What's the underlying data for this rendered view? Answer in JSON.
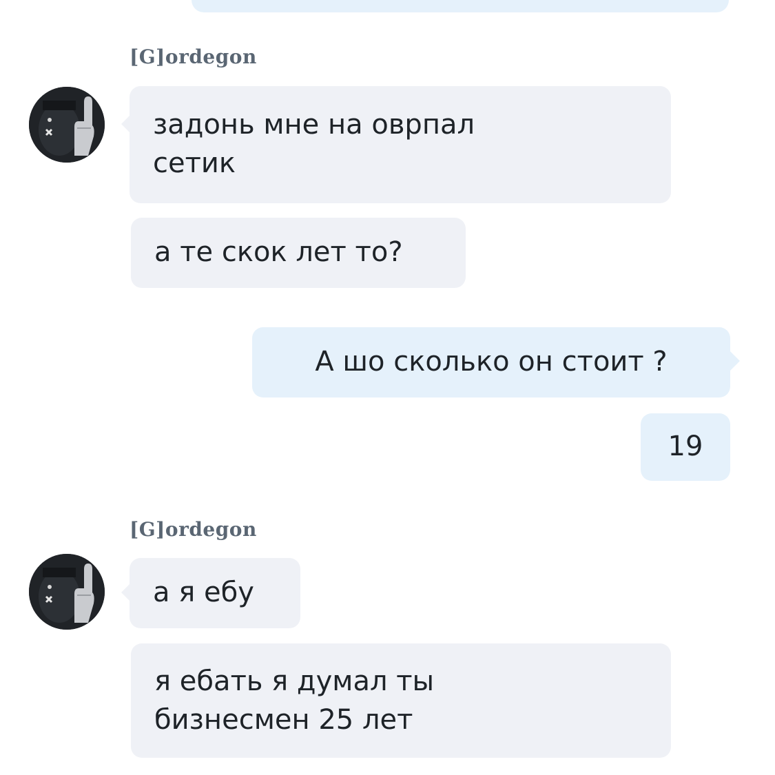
{
  "messages": [
    {
      "sender": "[G]ordegon",
      "texts": [
        "задонь мне на оврпал\nсетик",
        "а те скок лет то?"
      ]
    },
    {
      "outgoing": [
        "А шо сколько он стоит ?",
        "19"
      ]
    },
    {
      "sender": "[G]ordegon",
      "texts": [
        "а я ебу",
        "я ебать я думал ты\nбизнесмен 25 лет"
      ]
    }
  ],
  "avatar": {
    "icon": "masked-person-middle-finger-icon",
    "mark": "x"
  },
  "colors": {
    "incoming_bubble": "#eff1f6",
    "outgoing_bubble": "#e5f1fb",
    "sender_name": "#5a6673",
    "text": "#1e2328"
  }
}
